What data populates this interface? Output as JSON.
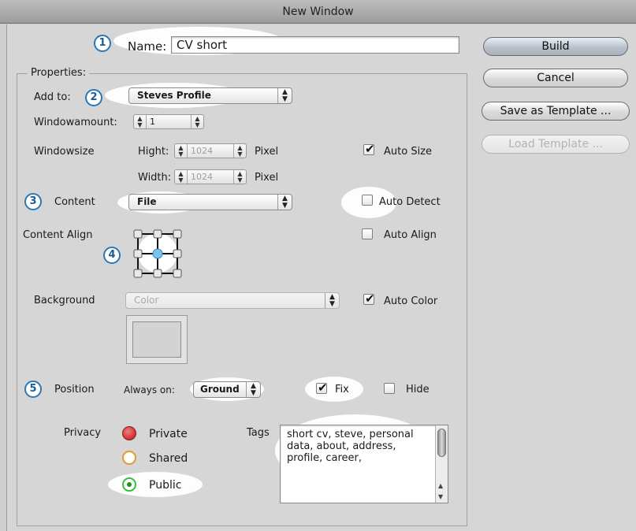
{
  "window": {
    "title": "New Window"
  },
  "name_row": {
    "label": "Name:",
    "value": "CV short"
  },
  "properties": {
    "legend": "Properties:",
    "add_to": {
      "label": "Add to:",
      "value": "Steves Profile"
    },
    "windowamount": {
      "label": "Windowamount:",
      "value": "1"
    },
    "windowsize": {
      "label": "Windowsize",
      "height_label": "Hight:",
      "height_value": "1024",
      "height_unit": "Pixel",
      "width_label": "Width:",
      "width_value": "1024",
      "width_unit": "Pixel",
      "auto_size_label": "Auto Size",
      "auto_size_checked": true
    },
    "content": {
      "label": "Content",
      "value": "File",
      "auto_detect_label": "Auto Detect",
      "auto_detect_checked": false
    },
    "content_align": {
      "label": "Content Align",
      "auto_align_label": "Auto Align",
      "auto_align_checked": false
    },
    "background": {
      "label": "Background",
      "value": "Color",
      "auto_color_label": "Auto Color",
      "auto_color_checked": true
    },
    "position": {
      "label": "Position",
      "always_on_label": "Always on:",
      "always_on_value": "Ground",
      "fix_label": "Fix",
      "fix_checked": true,
      "hide_label": "Hide",
      "hide_checked": false
    },
    "privacy": {
      "label": "Privacy",
      "options": [
        "Private",
        "Shared",
        "Public"
      ],
      "selected": "Public",
      "colors": {
        "private": "#d63a3a",
        "shared": "#e39a2b",
        "public": "#33c23a"
      }
    },
    "tags": {
      "label": "Tags",
      "value": "short cv, steve, personal data, about, address, profile, career,"
    }
  },
  "buttons": {
    "build": "Build",
    "cancel": "Cancel",
    "save_template": "Save as Template ...",
    "load_template": "Load Template ..."
  },
  "callouts": [
    "1",
    "2",
    "3",
    "4",
    "5"
  ]
}
